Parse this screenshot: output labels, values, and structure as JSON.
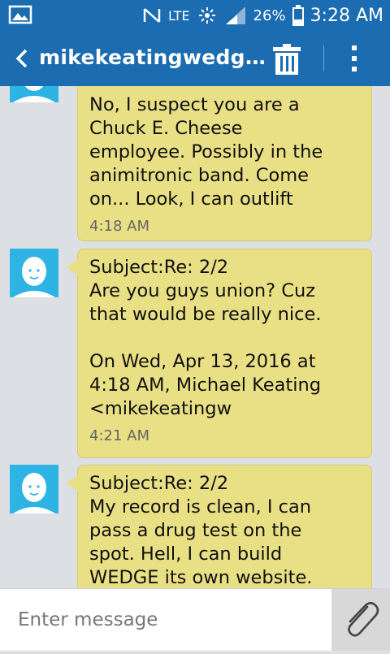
{
  "status_bar": {
    "network": "LTE",
    "battery": "26%",
    "time": "3:28 AM"
  },
  "header": {
    "title": "mikekeatingwedg…"
  },
  "messages": [
    {
      "subject": "",
      "text": "No, I suspect you are a\nChuck E. Cheese\nemployee. Possibly in the\nanimitronic band. Come\non... Look, I can outlift",
      "time": "4:18 AM"
    },
    {
      "subject": "Subject:Re: 2/2",
      "text": "Are you guys union? Cuz\nthat would be really nice.\n\nOn Wed, Apr 13, 2016 at\n4:18 AM, Michael Keating\n<mikekeatingw",
      "time": "4:21 AM"
    },
    {
      "subject": "Subject:Re: 2/2",
      "text": "My record is clean, I can\npass a drug test on the\nspot. Hell, I can build\nWEDGE its own website.",
      "time": ""
    }
  ],
  "composer": {
    "placeholder": "Enter message"
  },
  "colors": {
    "bar": "#1b6cb0",
    "bubble": "#e9df85",
    "avatar": "#2eb4e4",
    "background": "#dcdfe4"
  }
}
